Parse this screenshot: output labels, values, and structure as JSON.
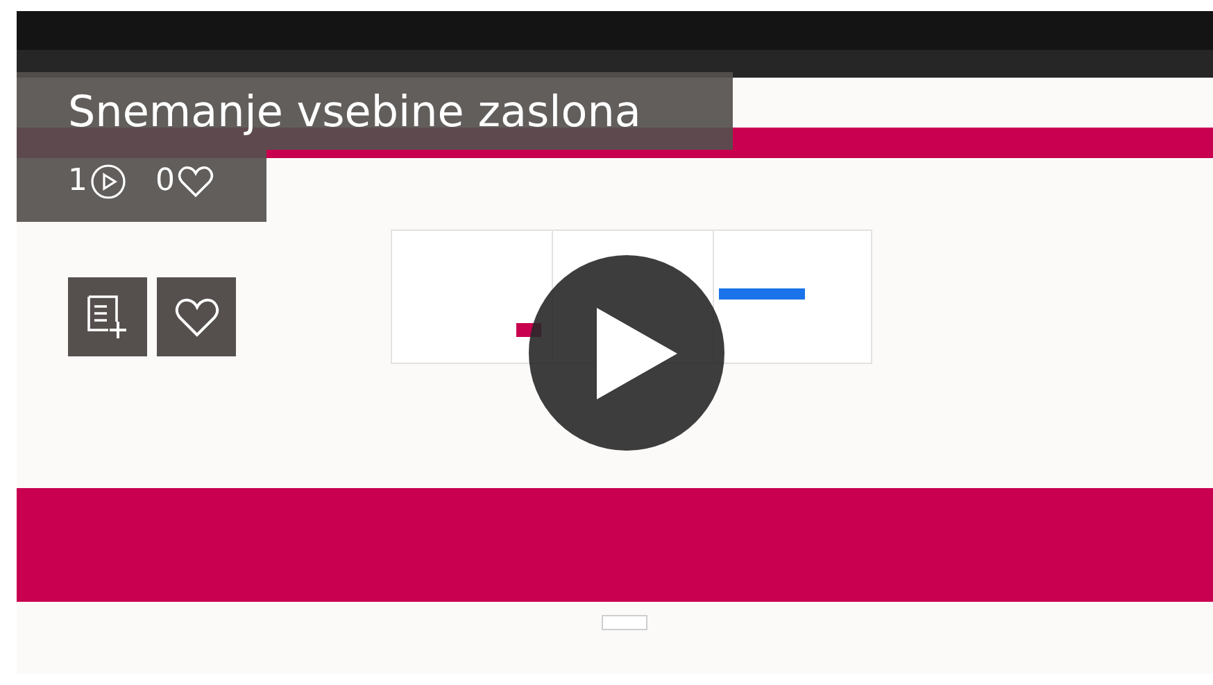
{
  "video": {
    "kind": "picture",
    "title": "Snemanje vsebine zaslona",
    "stats": [
      {
        "kind": "plays",
        "count": "1"
      },
      {
        "kind": "likes",
        "count": "0"
      }
    ],
    "actions": [
      {
        "kind": "playlist"
      },
      {
        "kind": "like"
      }
    ]
  }
}
